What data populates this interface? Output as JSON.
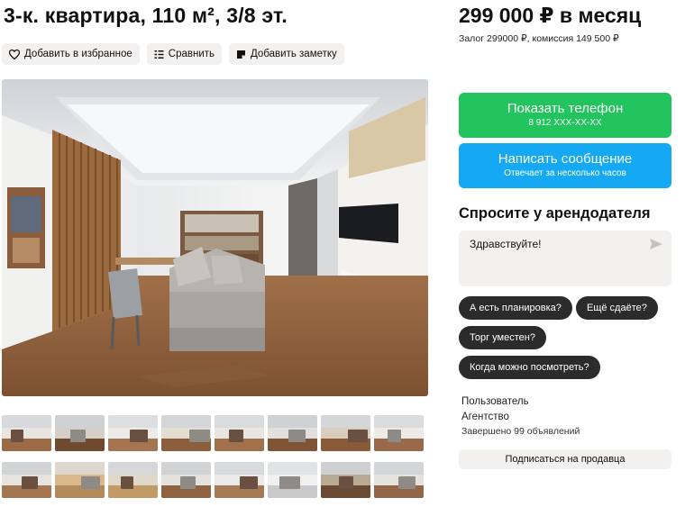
{
  "listing": {
    "title": "3-к. квартира, 110 м², 3/8 эт."
  },
  "actions": {
    "favorite": "Добавить в избранное",
    "compare": "Сравнить",
    "note": "Добавить заметку"
  },
  "price": {
    "amount": "299 000 ₽ в месяц",
    "deposit": "Залог 299000 ₽, комиссия 149 500 ₽"
  },
  "contact": {
    "phone_label": "Показать телефон",
    "phone_masked": "8 912 XXX-XX-XX",
    "message_label": "Написать сообщение",
    "message_sub": "Отвечает за несколько часов",
    "phone_color": "#21c45d",
    "message_color": "#14a9f2"
  },
  "ask": {
    "title": "Спросите у арендодателя",
    "message": "Здравствуйте!",
    "chips": [
      "А есть планировка?",
      "Ещё сдаёте?",
      "Торг уместен?",
      "Когда можно посмотреть?"
    ]
  },
  "seller": {
    "name": "Пользователь",
    "type": "Агентство",
    "completed": "Завершено 99 объявлений",
    "subscribe": "Подписаться на продавца"
  },
  "gallery": {
    "active_index": 2,
    "thumbnail_count": 16
  }
}
